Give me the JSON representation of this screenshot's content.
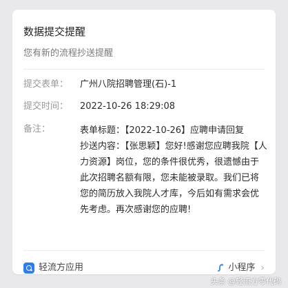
{
  "card": {
    "title": "数据提交提醒",
    "subtitle": "您有新的流程抄送提醒"
  },
  "fields": {
    "form_label": "提交表单：",
    "form_value": "广州八院招聘管理(石)-1",
    "time_label": "提交时间：",
    "time_value": "2022-10-26 18:29:08",
    "note_label": "备注："
  },
  "note": {
    "para1": "表单标题：【2022-10-26】应聘申请回复",
    "para2": "抄送内容：【张思颖】您好!感谢您应聘我院【人力资源】岗位，您的条件很优秀，很遗憾由于此次招聘名额有限，您未能被录取。我们已将您的简历放入我院人才库，今后如有需求会优先考虑。再次感谢您的应聘!"
  },
  "footer": {
    "app_name": "轻流方应用",
    "mini_program": "小程序",
    "chevron": "›"
  },
  "watermark": "头条 @轻流方零代码",
  "icons": {
    "app_logo": "app-logo-icon",
    "mini_program": "mini-program-icon",
    "chevron": "chevron-right-icon"
  },
  "colors": {
    "background": "#e9e9ec",
    "card": "#ffffff",
    "accent": "#2d7cf6",
    "label": "#9a9a9a",
    "text": "#2b2b2b"
  }
}
